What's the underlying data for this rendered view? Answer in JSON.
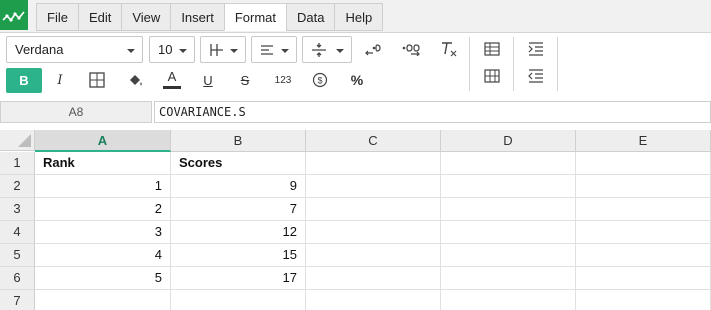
{
  "menubar": {
    "items": [
      "File",
      "Edit",
      "View",
      "Insert",
      "Format",
      "Data",
      "Help"
    ],
    "active": "Format"
  },
  "toolbar": {
    "font_family": "Verdana",
    "font_size": "10",
    "bold_label": "B",
    "italic_label": "I",
    "number_format_label": "123",
    "percent_label": "%",
    "accent_color": "#2db38b"
  },
  "formula_bar": {
    "cell_ref": "A8",
    "formula": "COVARIANCE.S"
  },
  "sheet": {
    "columns": [
      "A",
      "B",
      "C",
      "D",
      "E"
    ],
    "selected_column": "A",
    "rows": [
      {
        "num": "1",
        "cells": [
          "Rank",
          "Scores",
          "",
          "",
          ""
        ]
      },
      {
        "num": "2",
        "cells": [
          "1",
          "9",
          "",
          "",
          ""
        ]
      },
      {
        "num": "3",
        "cells": [
          "2",
          "7",
          "",
          "",
          ""
        ]
      },
      {
        "num": "4",
        "cells": [
          "3",
          "12",
          "",
          "",
          ""
        ]
      },
      {
        "num": "5",
        "cells": [
          "4",
          "15",
          "",
          "",
          ""
        ]
      },
      {
        "num": "6",
        "cells": [
          "5",
          "17",
          "",
          "",
          ""
        ]
      },
      {
        "num": "7",
        "cells": [
          "",
          "",
          "",
          "",
          ""
        ]
      }
    ]
  }
}
